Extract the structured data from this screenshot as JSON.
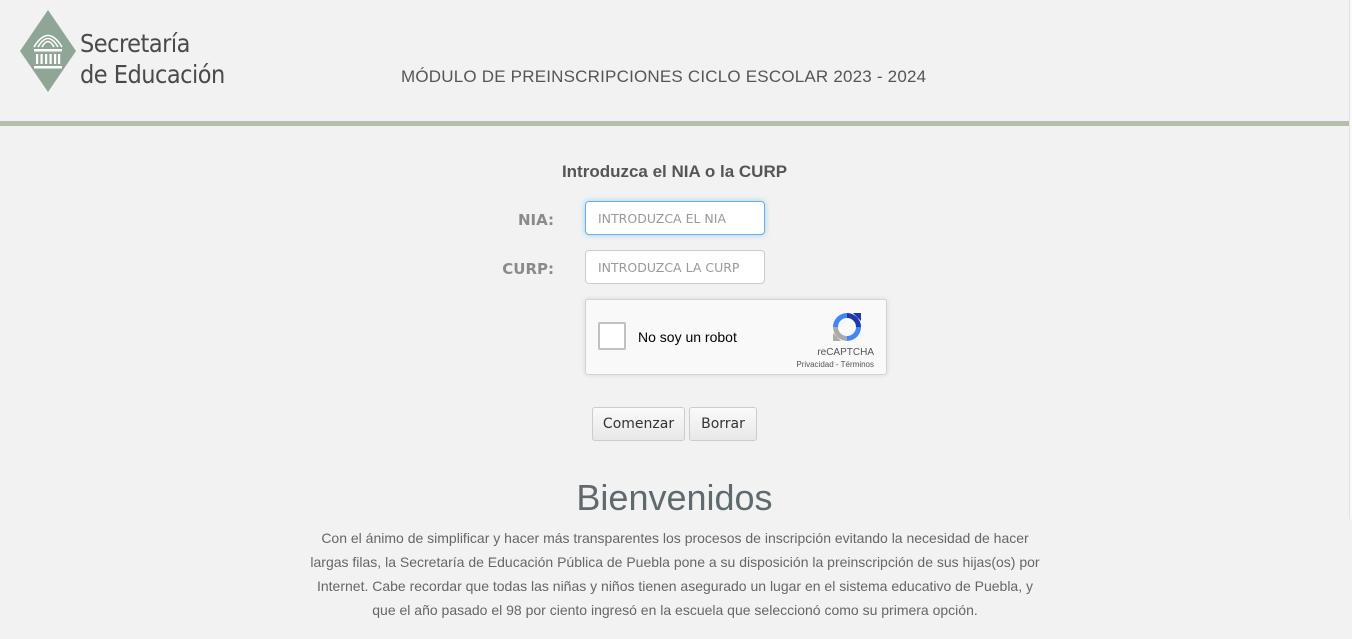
{
  "header": {
    "logo_line1": "Secretaría",
    "logo_line2": "de Educación",
    "module_title": "MÓDULO DE PREINSCRIPCIONES CICLO ESCOLAR 2023 - 2024"
  },
  "form": {
    "heading": "Introduzca el NIA o la CURP",
    "nia_label": "NIA:",
    "nia_placeholder": "INTRODUZCA EL NIA",
    "curp_label": "CURP:",
    "curp_placeholder": "INTRODUZCA LA CURP"
  },
  "recaptcha": {
    "label": "No soy un robot",
    "brand": "reCAPTCHA",
    "privacy": "Privacidad",
    "separator": " - ",
    "terms": "Términos"
  },
  "buttons": {
    "start": "Comenzar",
    "clear": "Borrar"
  },
  "welcome": {
    "title": "Bienvenidos",
    "text": "Con el ánimo de simplificar y hacer más transparentes los procesos de inscripción evitando la necesidad de hacer largas filas, la Secretaría de Educación Pública de Puebla pone a su disposición la preinscripción de sus hijas(os) por Internet. Cabe recordar que todas las niñas y niños tienen asegurado un lugar en el sistema educativo de Puebla, y que el año pasado el 98 por ciento ingresó en la escuela que seleccionó como su primera opción."
  },
  "colors": {
    "brand_green": "#8fa596",
    "header_rule": "#b4bfae",
    "focus_blue": "#66afe9"
  },
  "icons": {
    "logo": "secretaria-educacion-logo",
    "captcha": "recaptcha-logo-icon"
  }
}
